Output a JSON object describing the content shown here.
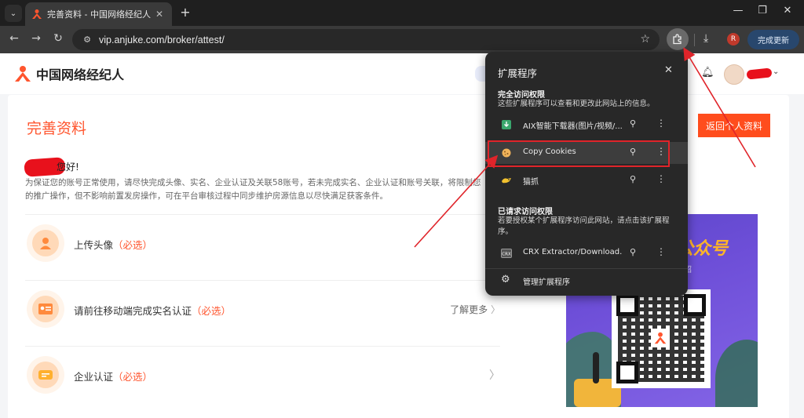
{
  "browser": {
    "tab_title": "完善资料 - 中国网络经纪人",
    "url": "vip.anjuke.com/broker/attest/",
    "profile_initial": "R",
    "update_label": "完成更新"
  },
  "site": {
    "logo_text": "中国网络经纪人"
  },
  "card": {
    "title": "完善资料",
    "return_button": "返回个人资料",
    "greeting": "您好!",
    "notice": "为保证您的账号正常使用，请尽快完成头像、实名、企业认证及关联58账号，若未完成实名、企业认证和账号关联，将限制您的推广操作，但不影响前置发房操作，可在平台审核过程中同步维护房源信息以尽快满足获客条件。",
    "steps": [
      {
        "label": "上传头像",
        "required": "（必选）",
        "more": ""
      },
      {
        "label": "请前往移动端完成实名认证",
        "required": "（必选）",
        "more": "了解更多"
      },
      {
        "label": "企业认证",
        "required": "（必选）",
        "more": ""
      }
    ]
  },
  "promo": {
    "title": "公众号",
    "sub": "绍"
  },
  "extensions_popup": {
    "title": "扩展程序",
    "full_access_heading": "完全访问权限",
    "full_access_desc": "这些扩展程序可以查看和更改此网站上的信息。",
    "full_access_items": [
      {
        "name": "AIX智能下载器(图片/视频/..."
      },
      {
        "name": "Copy Cookies"
      },
      {
        "name": "猫抓"
      }
    ],
    "requested_heading": "已请求访问权限",
    "requested_desc": "若要授权某个扩展程序访问此网站，请点击该扩展程序。",
    "requested_items": [
      {
        "name": "CRX Extractor/Download..."
      }
    ],
    "manage_label": "管理扩展程序"
  },
  "colors": {
    "accent": "#ff552e",
    "annotation": "#e0242a",
    "popup_bg": "#282828"
  }
}
